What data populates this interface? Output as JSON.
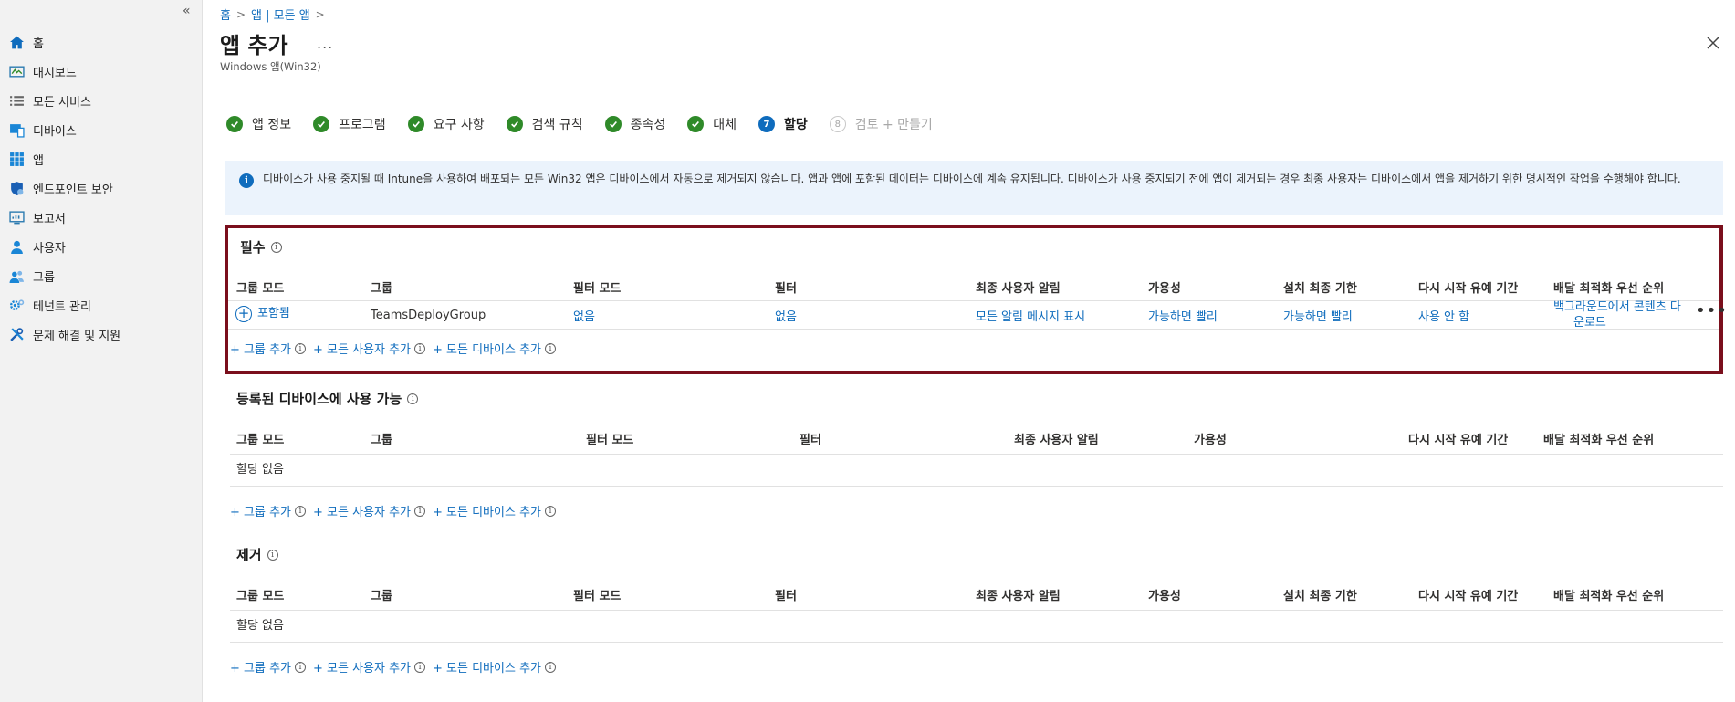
{
  "breadcrumb": {
    "home": "홈",
    "apps": "앱 | 모든 앱"
  },
  "page": {
    "title": "앱 추가",
    "subtitle": "Windows 앱(Win32)",
    "more": "..."
  },
  "sidebar": {
    "collapse": "«",
    "items": [
      {
        "label": "홈",
        "icon": "home-icon"
      },
      {
        "label": "대시보드",
        "icon": "dashboard-icon"
      },
      {
        "label": "모든 서비스",
        "icon": "list-icon"
      },
      {
        "label": "디바이스",
        "icon": "devices-icon"
      },
      {
        "label": "앱",
        "icon": "apps-grid-icon"
      },
      {
        "label": "엔드포인트 보안",
        "icon": "shield-icon"
      },
      {
        "label": "보고서",
        "icon": "reports-icon"
      },
      {
        "label": "사용자",
        "icon": "user-icon"
      },
      {
        "label": "그룹",
        "icon": "group-icon"
      },
      {
        "label": "테넌트 관리",
        "icon": "gear-icon"
      },
      {
        "label": "문제 해결 및 지원",
        "icon": "tools-icon"
      }
    ]
  },
  "steps": [
    {
      "label": "앱 정보",
      "state": "done"
    },
    {
      "label": "프로그램",
      "state": "done"
    },
    {
      "label": "요구 사항",
      "state": "done"
    },
    {
      "label": "검색 규칙",
      "state": "done"
    },
    {
      "label": "종속성",
      "state": "done"
    },
    {
      "label": "대체",
      "state": "done"
    },
    {
      "label": "할당",
      "state": "active",
      "num": "7"
    },
    {
      "label": "검토 + 만들기",
      "state": "disabled",
      "num": "8"
    }
  ],
  "info": {
    "text": "디바이스가 사용 중지될 때 Intune을 사용하여 배포되는 모든 Win32 앱은 디바이스에서 자동으로 제거되지 않습니다. 앱과 앱에 포함된 데이터는 디바이스에 계속 유지됩니다. 디바이스가 사용 중지되기 전에 앱이 제거되는 경우 최종 사용자는 디바이스에서 앱을 제거하기 위한 명시적인 작업을 수행해야 합니다."
  },
  "columns": {
    "group_mode": "그룹 모드",
    "group": "그룹",
    "filter_mode": "필터 모드",
    "filter": "필터",
    "notification": "최종 사용자 알림",
    "availability": "가용성",
    "deadline": "설치 최종 기한",
    "restart_grace": "다시 시작 유예 기간",
    "delivery_priority": "배달 최적화 우선 순위"
  },
  "adds": {
    "add_group": "+ 그룹 추가",
    "add_all_users": "+ 모든 사용자 추가",
    "add_all_devices": "+ 모든 디바이스 추가"
  },
  "required": {
    "title": "필수",
    "row": {
      "group_mode": "포함됨",
      "group": "TeamsDeployGroup",
      "filter_mode": "없음",
      "filter": "없음",
      "notification": "모든 알림 메시지 표시",
      "availability": "가능하면 빨리",
      "deadline": "가능하면 빨리",
      "restart_grace": "사용 안 함",
      "delivery_priority_1": "백그라운드에서 콘텐츠 다",
      "delivery_priority_2": "운로드"
    }
  },
  "available": {
    "title": "등록된 디바이스에 사용 가능",
    "empty": "할당 없음"
  },
  "uninstall": {
    "title": "제거",
    "empty": "할당 없음"
  }
}
